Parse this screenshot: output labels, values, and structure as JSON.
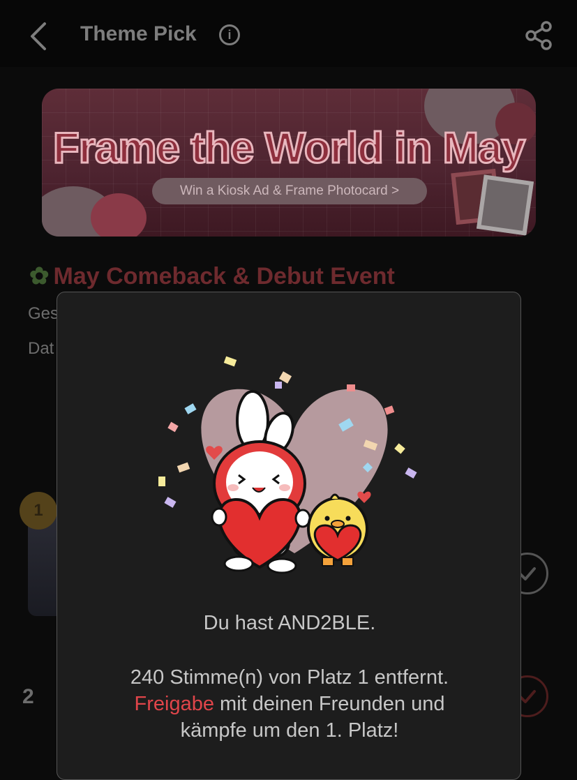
{
  "header": {
    "title": "Theme Pick"
  },
  "banner": {
    "headline": "Frame the World in May",
    "cta": "Win a Kiosk Ad & Frame Photocard >"
  },
  "event": {
    "title": "May Comeback & Debut Event",
    "row1_prefix": "Ges",
    "row2_prefix": "Dat"
  },
  "ranking": {
    "first_rank": "1",
    "second_rank": "2"
  },
  "modal": {
    "line1": "Du hast AND2BLE.",
    "line2": "240 Stimme(n) von Platz 1 entfernt.",
    "link_text": "Freigabe",
    "line3_rest": " mit deinen Freunden und",
    "line4": "kämpfe um den 1. Platz!"
  },
  "colors": {
    "accent_red": "#e0454a",
    "modal_bg": "#1d1d1d",
    "page_bg": "#0b0b0b"
  },
  "icons": [
    "back-arrow-icon",
    "info-icon",
    "share-icon",
    "leaf-icon",
    "check-icon"
  ]
}
